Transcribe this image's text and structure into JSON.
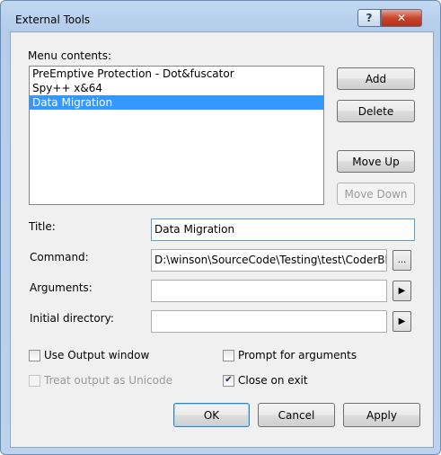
{
  "window": {
    "title": "External Tools",
    "help_glyph": "?",
    "close_glyph": "✕"
  },
  "menu_contents": {
    "label": "Menu contents:",
    "items": [
      {
        "label": "PreEmptive Protection - Dot&fuscator",
        "selected": false
      },
      {
        "label": "Spy++ x&64",
        "selected": false
      },
      {
        "label": "Data Migration",
        "selected": true
      }
    ]
  },
  "side_buttons": {
    "add": "Add",
    "delete": "Delete",
    "move_up": "Move Up",
    "move_down": "Move Down"
  },
  "fields": {
    "title": {
      "label": "Title:",
      "value": "Data Migration"
    },
    "command": {
      "label": "Command:",
      "value": "D:\\winson\\SourceCode\\Testing\\test\\CoderBlc",
      "browse": "..."
    },
    "arguments": {
      "label": "Arguments:",
      "value": "",
      "menu_arrow": "▶"
    },
    "initial_directory": {
      "label": "Initial directory:",
      "value": "",
      "menu_arrow": "▶"
    }
  },
  "options": {
    "use_output_window": {
      "label": "Use Output window",
      "checked": false,
      "enabled": true
    },
    "prompt_for_arguments": {
      "label": "Prompt for arguments",
      "checked": false,
      "enabled": true
    },
    "treat_output_as_unicode": {
      "label": "Treat output as Unicode",
      "checked": false,
      "enabled": false
    },
    "close_on_exit": {
      "label": "Close on exit",
      "checked": true,
      "enabled": true
    },
    "check_glyph": "✔"
  },
  "footer": {
    "ok": "OK",
    "cancel": "Cancel",
    "apply": "Apply"
  }
}
